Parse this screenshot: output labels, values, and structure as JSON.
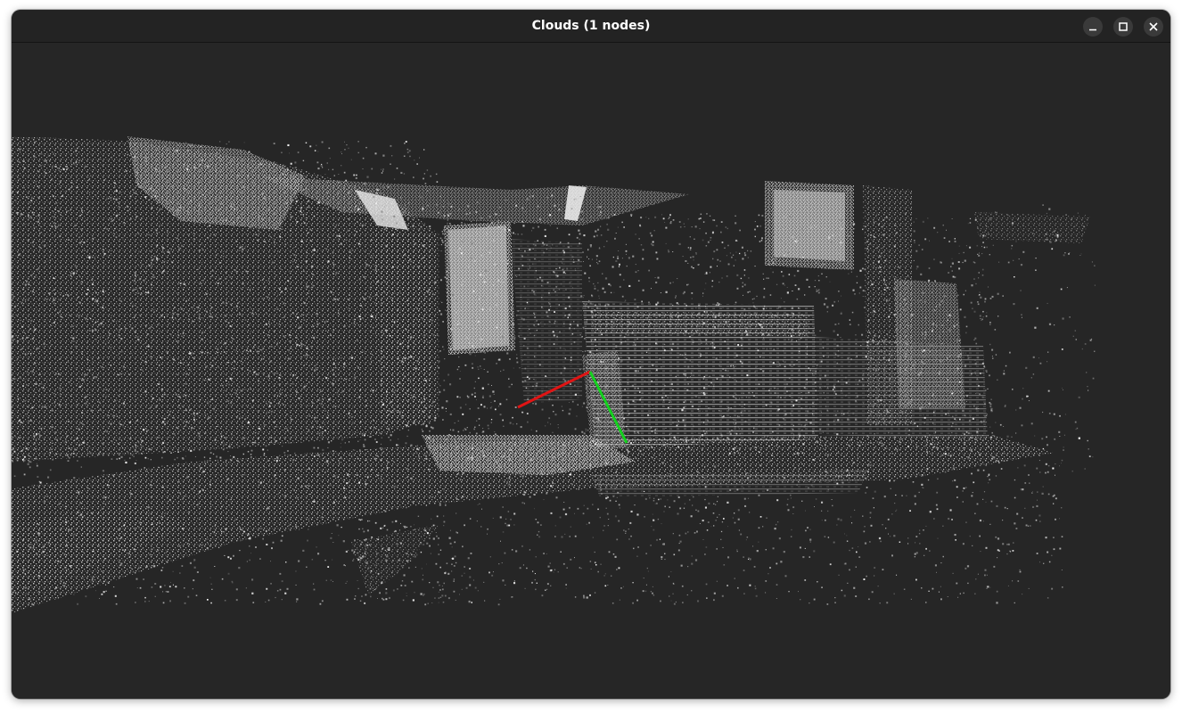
{
  "window": {
    "title": "Clouds (1 nodes)"
  },
  "title_buttons": [
    {
      "name": "minimize",
      "icon": "minimize-icon"
    },
    {
      "name": "maximize",
      "icon": "maximize-icon"
    },
    {
      "name": "close",
      "icon": "close-icon"
    }
  ],
  "viewer": {
    "background": "#262626",
    "point_color": "#c8c8c8",
    "axes": {
      "x_color": "#e01414",
      "y_color": "#14d21e"
    }
  }
}
